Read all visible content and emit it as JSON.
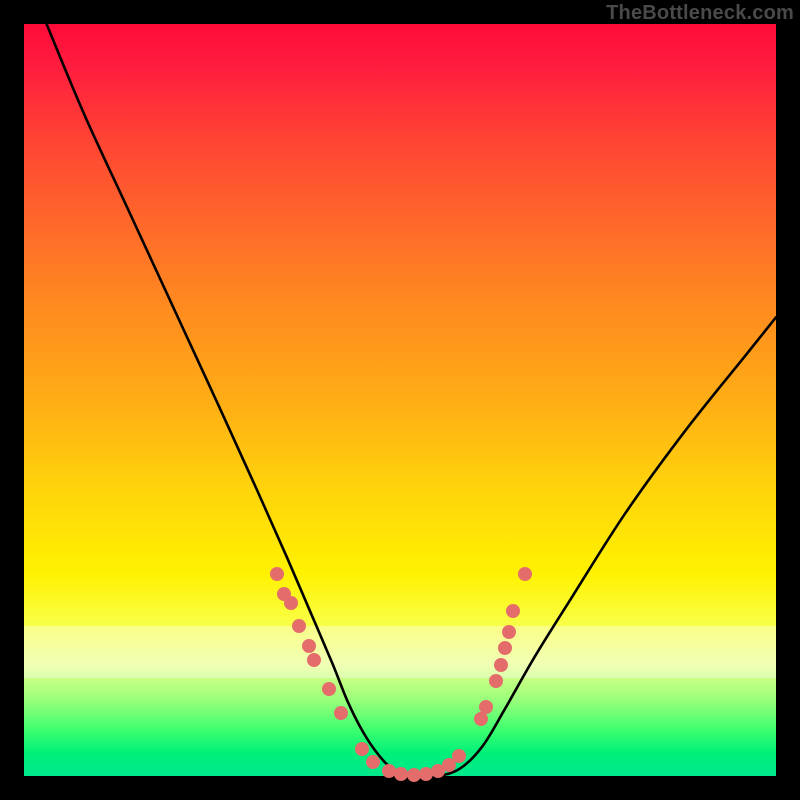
{
  "watermark": "TheBottleneck.com",
  "chart_data": {
    "type": "line",
    "title": "",
    "xlabel": "",
    "ylabel": "",
    "xlim": [
      0,
      100
    ],
    "ylim": [
      0,
      100
    ],
    "grid": false,
    "legend": "none",
    "background_gradient": {
      "direction": "vertical",
      "stops": [
        {
          "pos": 0,
          "color": "#ff0b3a"
        },
        {
          "pos": 50,
          "color": "#ffad15"
        },
        {
          "pos": 75,
          "color": "#fff200"
        },
        {
          "pos": 95,
          "color": "#3aff6f"
        },
        {
          "pos": 100,
          "color": "#00e88c"
        }
      ]
    },
    "pale_bands_y_pct_from_top": [
      {
        "top": 80.0,
        "height": 3.5
      },
      {
        "top": 83.5,
        "height": 3.5
      }
    ],
    "series": [
      {
        "name": "curve",
        "style": "line",
        "color": "#000000",
        "x": [
          3,
          8,
          14,
          20,
          26,
          31,
          35,
          38,
          41,
          43,
          45,
          47,
          49,
          52,
          55,
          58,
          61,
          64,
          68,
          73,
          80,
          88,
          96,
          100
        ],
        "y": [
          100,
          88,
          75,
          62,
          49,
          38,
          29,
          22,
          15,
          10,
          6,
          3,
          1,
          0,
          0,
          1,
          4,
          9,
          16,
          24,
          35,
          46,
          56,
          61
        ]
      },
      {
        "name": "markers",
        "style": "scatter",
        "color": "#e46d6b",
        "points": [
          {
            "x": 33.7,
            "y": 26.8
          },
          {
            "x": 34.6,
            "y": 24.2
          },
          {
            "x": 35.5,
            "y": 23.0
          },
          {
            "x": 36.6,
            "y": 20.0
          },
          {
            "x": 37.9,
            "y": 17.3
          },
          {
            "x": 38.6,
            "y": 15.4
          },
          {
            "x": 40.5,
            "y": 11.6
          },
          {
            "x": 42.1,
            "y": 8.4
          },
          {
            "x": 44.9,
            "y": 3.6
          },
          {
            "x": 46.4,
            "y": 1.8
          },
          {
            "x": 48.5,
            "y": 0.6
          },
          {
            "x": 50.1,
            "y": 0.2
          },
          {
            "x": 51.9,
            "y": 0.1
          },
          {
            "x": 53.5,
            "y": 0.2
          },
          {
            "x": 55.0,
            "y": 0.6
          },
          {
            "x": 56.5,
            "y": 1.4
          },
          {
            "x": 57.8,
            "y": 2.6
          },
          {
            "x": 60.8,
            "y": 7.6
          },
          {
            "x": 61.4,
            "y": 9.2
          },
          {
            "x": 62.8,
            "y": 12.6
          },
          {
            "x": 63.4,
            "y": 14.8
          },
          {
            "x": 64.0,
            "y": 17.0
          },
          {
            "x": 64.5,
            "y": 19.2
          },
          {
            "x": 65.0,
            "y": 22.0
          },
          {
            "x": 66.6,
            "y": 26.8
          }
        ]
      }
    ]
  }
}
